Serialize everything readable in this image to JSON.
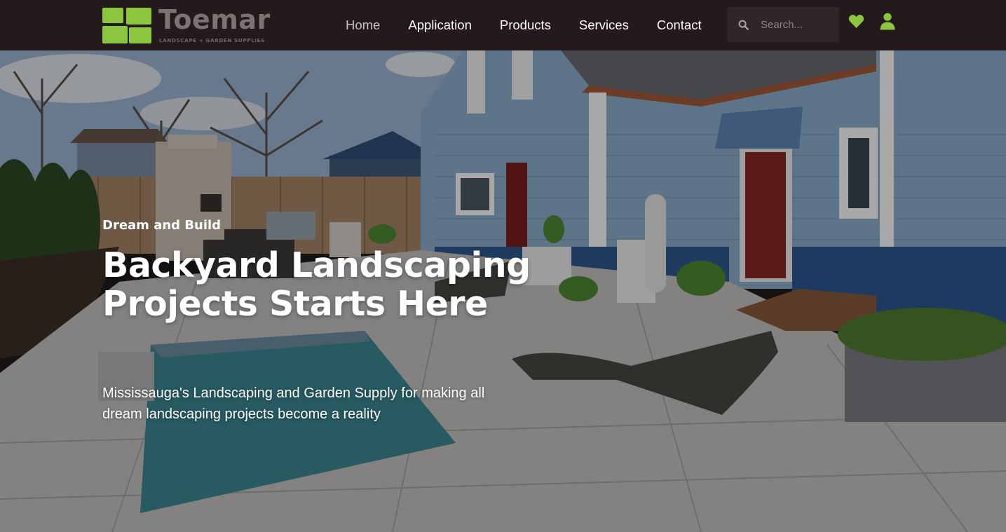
{
  "brand": {
    "name": "Toemar",
    "tagline": "LANDSCAPE + GARDEN SUPPLIES",
    "accent_color": "#8cc63f",
    "header_bg": "#251a1b"
  },
  "nav": {
    "items": [
      {
        "label": "Home",
        "active": true
      },
      {
        "label": "Application",
        "active": false
      },
      {
        "label": "Products",
        "active": false
      },
      {
        "label": "Services",
        "active": false
      },
      {
        "label": "Contact",
        "active": false
      }
    ]
  },
  "search": {
    "placeholder": "Search...",
    "value": "",
    "icon": "search-icon"
  },
  "actions": {
    "wishlist_icon": "heart-icon",
    "account_icon": "user-icon"
  },
  "hero": {
    "eyebrow": "Dream and Build",
    "title": "Backyard Landscaping Projects Starts Here",
    "subtitle": "Mississauga's Landscaping and Garden Supply for making all dream landscaping projects become a reality"
  }
}
